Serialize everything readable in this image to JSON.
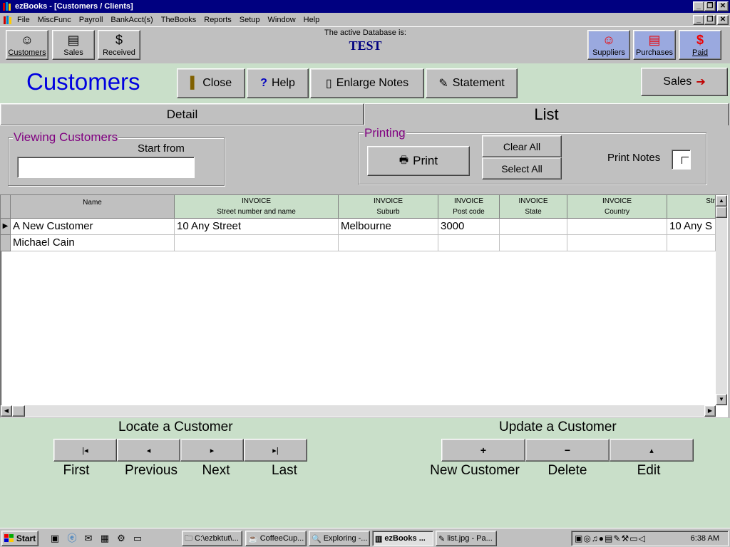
{
  "window": {
    "title": "ezBooks - [Customers / Clients]",
    "controls": [
      "_",
      "❐",
      "✕"
    ]
  },
  "menu": [
    "File",
    "MiscFunc",
    "Payroll",
    "BankAcct(s)",
    "TheBooks",
    "Reports",
    "Setup",
    "Window",
    "Help"
  ],
  "toolbar": {
    "left": [
      {
        "label": "Customers",
        "icon": "smiley-icon"
      },
      {
        "label": "Sales",
        "icon": "documents-icon"
      },
      {
        "label": "Received",
        "icon": "dollar-icon"
      }
    ],
    "right": [
      {
        "label": "Suppliers",
        "icon": "smiley-icon"
      },
      {
        "label": "Purchases",
        "icon": "documents-icon"
      },
      {
        "label": "Paid",
        "icon": "dollar-icon"
      }
    ],
    "db_label": "The active Database is:",
    "db_name": "TEST"
  },
  "header": {
    "title": "Customers",
    "close": "Close",
    "help": "Help",
    "enlarge_notes": "Enlarge Notes",
    "statement": "Statement",
    "sales": "Sales"
  },
  "tabs": {
    "detail": "Detail",
    "list": "List"
  },
  "viewing": {
    "group_label": "Viewing Customers",
    "start_from": "Start from",
    "start_value": ""
  },
  "printing": {
    "group_label": "Printing",
    "print": "Print",
    "clear_all": "Clear All",
    "select_all": "Select All",
    "print_notes": "Print Notes",
    "print_notes_checked": false
  },
  "grid": {
    "columns": [
      {
        "l1": "Name",
        "l2": ""
      },
      {
        "l1": "INVOICE",
        "l2": "Street  number and name"
      },
      {
        "l1": "INVOICE",
        "l2": "Suburb"
      },
      {
        "l1": "INVOICE",
        "l2": "Post code"
      },
      {
        "l1": "INVOICE",
        "l2": "State"
      },
      {
        "l1": "INVOICE",
        "l2": "Country"
      },
      {
        "l1": "",
        "l2": "Str"
      }
    ],
    "rows": [
      [
        "A New Customer",
        "10 Any Street",
        "Melbourne",
        "3000",
        "",
        "",
        "10 Any S"
      ],
      [
        "Michael Cain",
        "",
        "",
        "",
        "",
        "",
        ""
      ]
    ]
  },
  "locate": {
    "title": "Locate a Customer",
    "first": "First",
    "previous": "Previous",
    "next": "Next",
    "last": "Last"
  },
  "update": {
    "title": "Update a Customer",
    "new": "New Customer",
    "delete": "Delete",
    "edit": "Edit"
  },
  "taskbar": {
    "start": "Start",
    "tasks": [
      {
        "label": "C:\\ezbktut\\...",
        "active": false
      },
      {
        "label": "CoffeeCup...",
        "active": false
      },
      {
        "label": "Exploring -...",
        "active": false
      },
      {
        "label": "ezBooks ...",
        "active": true
      },
      {
        "label": "list.jpg - Pa...",
        "active": false
      }
    ],
    "clock": "6:38 AM"
  },
  "colors": {
    "title_bar": "#000080",
    "panel_green": "#c9dfc9",
    "title_blue": "#0000e0",
    "group_label_purple": "#800080",
    "supplier_button_blue": "#9aa9df"
  }
}
